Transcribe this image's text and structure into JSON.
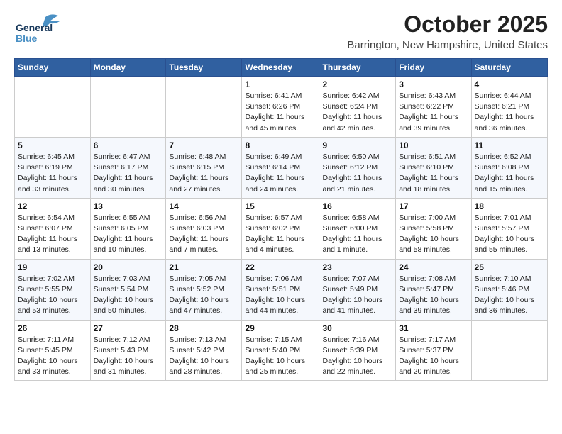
{
  "header": {
    "logo_line1": "General",
    "logo_line2": "Blue",
    "month": "October 2025",
    "location": "Barrington, New Hampshire, United States"
  },
  "weekdays": [
    "Sunday",
    "Monday",
    "Tuesday",
    "Wednesday",
    "Thursday",
    "Friday",
    "Saturday"
  ],
  "weeks": [
    [
      {
        "day": "",
        "info": ""
      },
      {
        "day": "",
        "info": ""
      },
      {
        "day": "",
        "info": ""
      },
      {
        "day": "1",
        "info": "Sunrise: 6:41 AM\nSunset: 6:26 PM\nDaylight: 11 hours\nand 45 minutes."
      },
      {
        "day": "2",
        "info": "Sunrise: 6:42 AM\nSunset: 6:24 PM\nDaylight: 11 hours\nand 42 minutes."
      },
      {
        "day": "3",
        "info": "Sunrise: 6:43 AM\nSunset: 6:22 PM\nDaylight: 11 hours\nand 39 minutes."
      },
      {
        "day": "4",
        "info": "Sunrise: 6:44 AM\nSunset: 6:21 PM\nDaylight: 11 hours\nand 36 minutes."
      }
    ],
    [
      {
        "day": "5",
        "info": "Sunrise: 6:45 AM\nSunset: 6:19 PM\nDaylight: 11 hours\nand 33 minutes."
      },
      {
        "day": "6",
        "info": "Sunrise: 6:47 AM\nSunset: 6:17 PM\nDaylight: 11 hours\nand 30 minutes."
      },
      {
        "day": "7",
        "info": "Sunrise: 6:48 AM\nSunset: 6:15 PM\nDaylight: 11 hours\nand 27 minutes."
      },
      {
        "day": "8",
        "info": "Sunrise: 6:49 AM\nSunset: 6:14 PM\nDaylight: 11 hours\nand 24 minutes."
      },
      {
        "day": "9",
        "info": "Sunrise: 6:50 AM\nSunset: 6:12 PM\nDaylight: 11 hours\nand 21 minutes."
      },
      {
        "day": "10",
        "info": "Sunrise: 6:51 AM\nSunset: 6:10 PM\nDaylight: 11 hours\nand 18 minutes."
      },
      {
        "day": "11",
        "info": "Sunrise: 6:52 AM\nSunset: 6:08 PM\nDaylight: 11 hours\nand 15 minutes."
      }
    ],
    [
      {
        "day": "12",
        "info": "Sunrise: 6:54 AM\nSunset: 6:07 PM\nDaylight: 11 hours\nand 13 minutes."
      },
      {
        "day": "13",
        "info": "Sunrise: 6:55 AM\nSunset: 6:05 PM\nDaylight: 11 hours\nand 10 minutes."
      },
      {
        "day": "14",
        "info": "Sunrise: 6:56 AM\nSunset: 6:03 PM\nDaylight: 11 hours\nand 7 minutes."
      },
      {
        "day": "15",
        "info": "Sunrise: 6:57 AM\nSunset: 6:02 PM\nDaylight: 11 hours\nand 4 minutes."
      },
      {
        "day": "16",
        "info": "Sunrise: 6:58 AM\nSunset: 6:00 PM\nDaylight: 11 hours\nand 1 minute."
      },
      {
        "day": "17",
        "info": "Sunrise: 7:00 AM\nSunset: 5:58 PM\nDaylight: 10 hours\nand 58 minutes."
      },
      {
        "day": "18",
        "info": "Sunrise: 7:01 AM\nSunset: 5:57 PM\nDaylight: 10 hours\nand 55 minutes."
      }
    ],
    [
      {
        "day": "19",
        "info": "Sunrise: 7:02 AM\nSunset: 5:55 PM\nDaylight: 10 hours\nand 53 minutes."
      },
      {
        "day": "20",
        "info": "Sunrise: 7:03 AM\nSunset: 5:54 PM\nDaylight: 10 hours\nand 50 minutes."
      },
      {
        "day": "21",
        "info": "Sunrise: 7:05 AM\nSunset: 5:52 PM\nDaylight: 10 hours\nand 47 minutes."
      },
      {
        "day": "22",
        "info": "Sunrise: 7:06 AM\nSunset: 5:51 PM\nDaylight: 10 hours\nand 44 minutes."
      },
      {
        "day": "23",
        "info": "Sunrise: 7:07 AM\nSunset: 5:49 PM\nDaylight: 10 hours\nand 41 minutes."
      },
      {
        "day": "24",
        "info": "Sunrise: 7:08 AM\nSunset: 5:47 PM\nDaylight: 10 hours\nand 39 minutes."
      },
      {
        "day": "25",
        "info": "Sunrise: 7:10 AM\nSunset: 5:46 PM\nDaylight: 10 hours\nand 36 minutes."
      }
    ],
    [
      {
        "day": "26",
        "info": "Sunrise: 7:11 AM\nSunset: 5:45 PM\nDaylight: 10 hours\nand 33 minutes."
      },
      {
        "day": "27",
        "info": "Sunrise: 7:12 AM\nSunset: 5:43 PM\nDaylight: 10 hours\nand 31 minutes."
      },
      {
        "day": "28",
        "info": "Sunrise: 7:13 AM\nSunset: 5:42 PM\nDaylight: 10 hours\nand 28 minutes."
      },
      {
        "day": "29",
        "info": "Sunrise: 7:15 AM\nSunset: 5:40 PM\nDaylight: 10 hours\nand 25 minutes."
      },
      {
        "day": "30",
        "info": "Sunrise: 7:16 AM\nSunset: 5:39 PM\nDaylight: 10 hours\nand 22 minutes."
      },
      {
        "day": "31",
        "info": "Sunrise: 7:17 AM\nSunset: 5:37 PM\nDaylight: 10 hours\nand 20 minutes."
      },
      {
        "day": "",
        "info": ""
      }
    ]
  ]
}
